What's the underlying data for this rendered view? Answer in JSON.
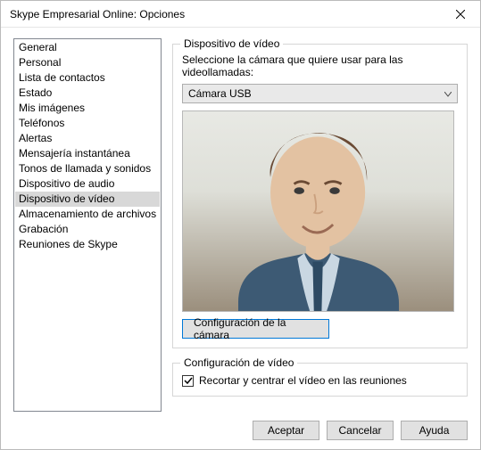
{
  "window": {
    "title": "Skype Empresarial Online: Opciones"
  },
  "sidebar": {
    "items": [
      {
        "label": "General"
      },
      {
        "label": "Personal"
      },
      {
        "label": "Lista de contactos"
      },
      {
        "label": "Estado"
      },
      {
        "label": "Mis imágenes"
      },
      {
        "label": "Teléfonos"
      },
      {
        "label": "Alertas"
      },
      {
        "label": "Mensajería instantánea"
      },
      {
        "label": "Tonos de llamada y sonidos"
      },
      {
        "label": "Dispositivo de audio"
      },
      {
        "label": "Dispositivo de vídeo"
      },
      {
        "label": "Almacenamiento de archivos"
      },
      {
        "label": "Grabación"
      },
      {
        "label": "Reuniones de Skype"
      }
    ],
    "selected_index": 10
  },
  "video_device_group": {
    "title": "Dispositivo de vídeo",
    "instruction": "Seleccione la cámara que quiere usar para las videollamadas:",
    "selected_camera": "Cámara USB",
    "camera_settings_button": "Configuración de la cámara"
  },
  "video_settings_group": {
    "title": "Configuración de vídeo",
    "crop_center_label": "Recortar y centrar el vídeo en las reuniones",
    "crop_center_checked": true
  },
  "footer": {
    "ok": "Aceptar",
    "cancel": "Cancelar",
    "help": "Ayuda"
  }
}
